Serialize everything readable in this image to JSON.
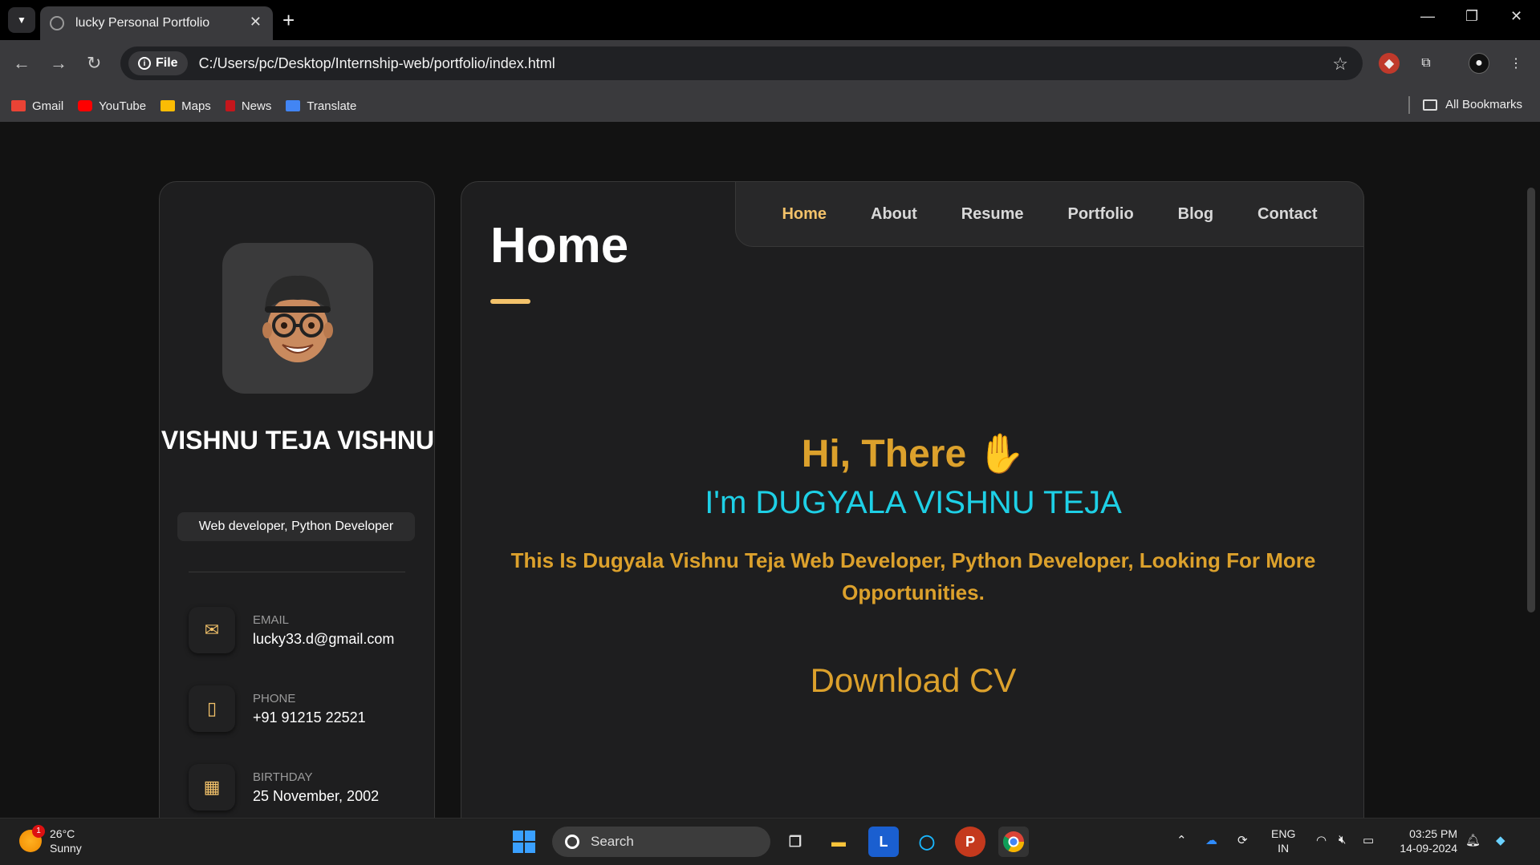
{
  "browser": {
    "tab_title": "lucky Personal Portfolio",
    "omnibox_chip": "File",
    "url": "C:/Users/pc/Desktop/Internship-web/portfolio/index.html",
    "bookmarks": [
      {
        "label": "Gmail",
        "color": "#ea4335"
      },
      {
        "label": "YouTube",
        "color": "#ff0000"
      },
      {
        "label": "Maps",
        "color": "#fbbc04"
      },
      {
        "label": "News",
        "color": "#c4161c"
      },
      {
        "label": "Translate",
        "color": "#4285f4"
      }
    ],
    "all_bookmarks": "All Bookmarks"
  },
  "sidebar": {
    "name": "VISHNU TEJA VISHNU",
    "role": "Web developer, Python Developer",
    "contacts": [
      {
        "label": "Email",
        "value": "lucky33.d@gmail.com",
        "icon": "mail-icon"
      },
      {
        "label": "Phone",
        "value": "+91 91215 22521",
        "icon": "phone-icon"
      },
      {
        "label": "Birthday",
        "value": "25 November, 2002",
        "icon": "calendar-icon"
      }
    ]
  },
  "nav": {
    "items": [
      "Home",
      "About",
      "Resume",
      "Portfolio",
      "Blog",
      "Contact"
    ],
    "active": "Home"
  },
  "main": {
    "title": "Home",
    "greeting": "Hi, There",
    "wave": "✋",
    "intro": "I'm DUGYALA VISHNU TEJA",
    "description": "This Is Dugyala Vishnu Teja Web Developer, Python Developer, Looking For More Opportunities.",
    "cv_label": "Download CV"
  },
  "colors": {
    "accent": "#f3c26a",
    "gold": "#dca12c",
    "cyan": "#1ed0e6"
  },
  "taskbar": {
    "temperature": "26°C",
    "weather": "Sunny",
    "weather_badge": "1",
    "search_placeholder": "Search",
    "lang_top": "ENG",
    "lang_bottom": "IN",
    "time": "03:25 PM",
    "date": "14-09-2024"
  }
}
